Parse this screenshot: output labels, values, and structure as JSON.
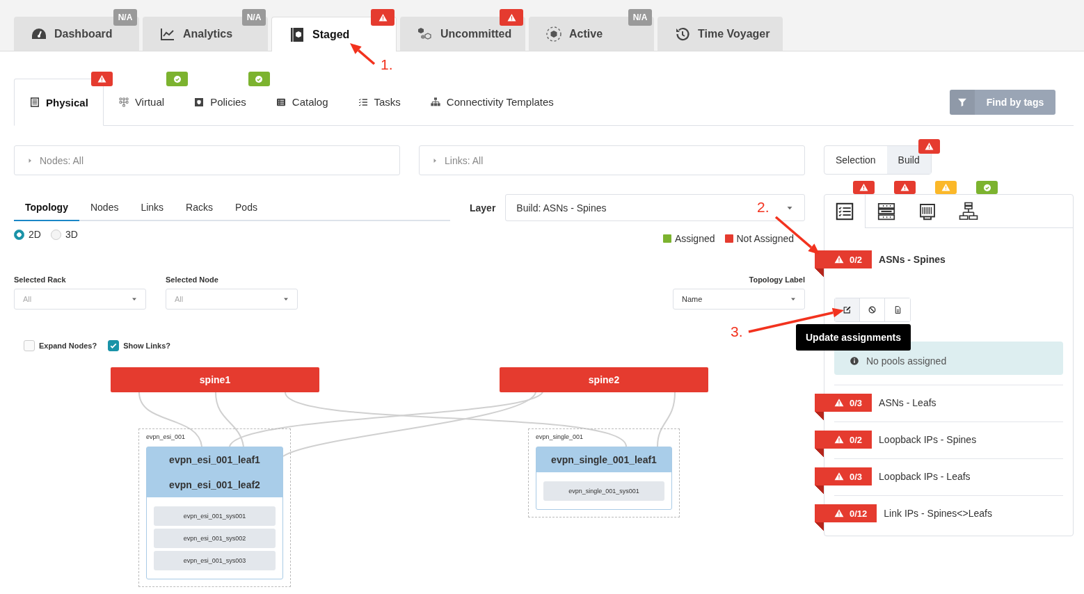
{
  "top_tabs": [
    {
      "label": "Dashboard",
      "selected": false,
      "badge": {
        "kind": "na",
        "text": "N/A"
      }
    },
    {
      "label": "Analytics",
      "selected": false,
      "badge": {
        "kind": "na",
        "text": "N/A"
      }
    },
    {
      "label": "Staged",
      "selected": true,
      "badge": {
        "kind": "warning"
      }
    },
    {
      "label": "Uncommitted",
      "selected": false,
      "badge": {
        "kind": "warning"
      }
    },
    {
      "label": "Active",
      "selected": false,
      "badge": {
        "kind": "na",
        "text": "N/A"
      }
    },
    {
      "label": "Time Voyager",
      "selected": false
    }
  ],
  "sub_tabs": [
    {
      "label": "Physical",
      "selected": true,
      "badge": {
        "kind": "warning"
      }
    },
    {
      "label": "Virtual",
      "selected": false,
      "badge": {
        "kind": "ok"
      }
    },
    {
      "label": "Policies",
      "selected": false,
      "badge": {
        "kind": "ok"
      }
    },
    {
      "label": "Catalog",
      "selected": false
    },
    {
      "label": "Tasks",
      "selected": false
    },
    {
      "label": "Connectivity Templates",
      "selected": false
    }
  ],
  "find_by_tags": {
    "label": "Find by tags",
    "disabled": true
  },
  "filters": [
    {
      "label": "Nodes: All",
      "expanded": false
    },
    {
      "label": "Links: All",
      "expanded": false
    }
  ],
  "view_tabs": [
    {
      "label": "Topology",
      "selected": true
    },
    {
      "label": "Nodes",
      "selected": false
    },
    {
      "label": "Links",
      "selected": false
    },
    {
      "label": "Racks",
      "selected": false
    },
    {
      "label": "Pods",
      "selected": false
    }
  ],
  "layer": {
    "label": "Layer",
    "value": "Build: ASNs - Spines"
  },
  "dimension_options": [
    {
      "label": "2D",
      "selected": true
    },
    {
      "label": "3D",
      "selected": false
    }
  ],
  "legend": [
    {
      "label": "Assigned",
      "color": "#7cb32f"
    },
    {
      "label": "Not Assigned",
      "color": "#e53b2f"
    }
  ],
  "selects": [
    {
      "label": "Selected Rack",
      "placeholder": "All"
    },
    {
      "label": "Selected Node",
      "placeholder": "All"
    },
    {
      "label": "Topology Label",
      "value": "Name"
    }
  ],
  "toggles": [
    {
      "label": "Expand Nodes?",
      "checked": false
    },
    {
      "label": "Show Links?",
      "checked": true
    }
  ],
  "topology": {
    "spines": [
      {
        "name": "spine1",
        "assigned": false
      },
      {
        "name": "spine2",
        "assigned": false
      }
    ],
    "groups": [
      {
        "label": "evpn_esi_001",
        "leafs": [
          {
            "name": "evpn_esi_001_leaf1"
          },
          {
            "name": "evpn_esi_001_leaf2"
          }
        ],
        "systems": [
          {
            "name": "evpn_esi_001_sys001"
          },
          {
            "name": "evpn_esi_001_sys002"
          },
          {
            "name": "evpn_esi_001_sys003"
          }
        ]
      },
      {
        "label": "evpn_single_001",
        "leafs": [
          {
            "name": "evpn_single_001_leaf1"
          }
        ],
        "systems": [
          {
            "name": "evpn_single_001_sys001"
          }
        ]
      }
    ]
  },
  "mode_tabs": [
    {
      "label": "Selection",
      "selected": false
    },
    {
      "label": "Build",
      "selected": true,
      "badge": {
        "kind": "warning"
      }
    }
  ],
  "build_tabs": [
    {
      "selected": true,
      "badge": {
        "kind": "warning"
      }
    },
    {
      "selected": false,
      "badge": {
        "kind": "warning"
      }
    },
    {
      "selected": false,
      "badge": {
        "kind": "caution"
      }
    },
    {
      "selected": false,
      "badge": {
        "kind": "ok"
      }
    }
  ],
  "resources": [
    {
      "count": "0/2",
      "label": "ASNs - Spines",
      "expanded": true,
      "message": "No pools assigned"
    },
    {
      "count": "0/3",
      "label": "ASNs - Leafs",
      "expanded": false
    },
    {
      "count": "0/2",
      "label": "Loopback IPs - Spines",
      "expanded": false
    },
    {
      "count": "0/3",
      "label": "Loopback IPs - Leafs",
      "expanded": false
    },
    {
      "count": "0/12",
      "label": "Link IPs - Spines<>Leafs",
      "expanded": false
    }
  ],
  "tooltip": {
    "text": "Update assignments"
  },
  "annotations": [
    {
      "label": "1."
    },
    {
      "label": "2."
    },
    {
      "label": "3."
    }
  ]
}
